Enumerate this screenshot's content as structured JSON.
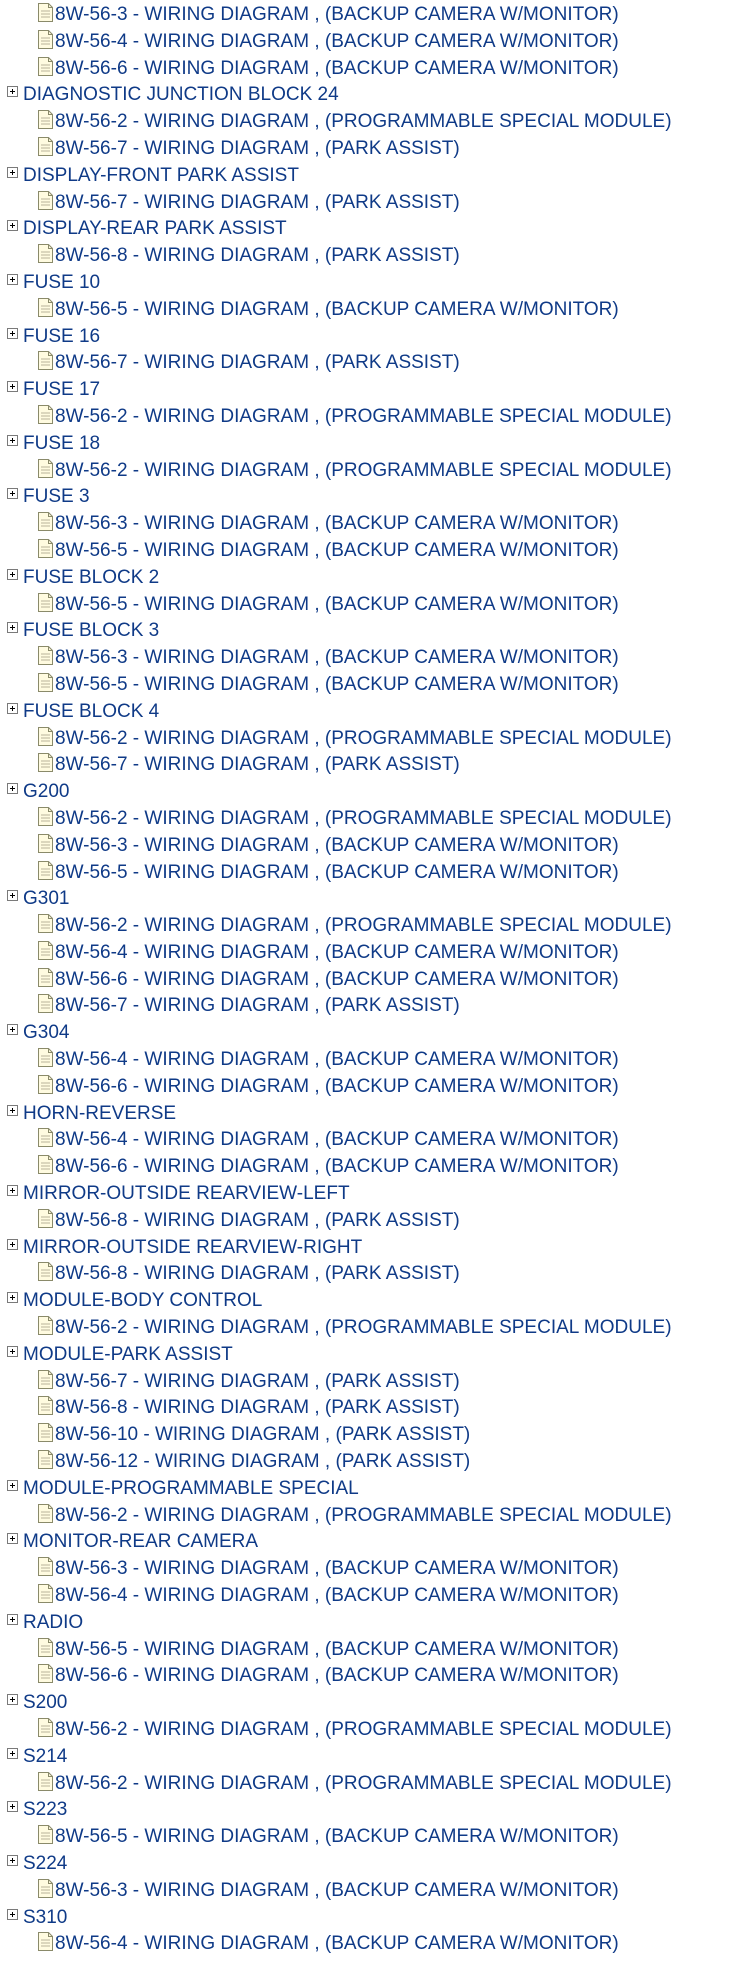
{
  "tree": [
    {
      "type": "doc",
      "label": "8W-56-3 - WIRING DIAGRAM , (BACKUP CAMERA W/MONITOR)"
    },
    {
      "type": "doc",
      "label": "8W-56-4 - WIRING DIAGRAM , (BACKUP CAMERA W/MONITOR)"
    },
    {
      "type": "doc",
      "label": "8W-56-6 - WIRING DIAGRAM , (BACKUP CAMERA W/MONITOR)"
    },
    {
      "type": "group",
      "label": "DIAGNOSTIC JUNCTION BLOCK 24"
    },
    {
      "type": "doc",
      "label": "8W-56-2 - WIRING DIAGRAM , (PROGRAMMABLE SPECIAL MODULE)"
    },
    {
      "type": "doc",
      "label": "8W-56-7 - WIRING DIAGRAM , (PARK ASSIST)"
    },
    {
      "type": "group",
      "label": "DISPLAY-FRONT PARK ASSIST"
    },
    {
      "type": "doc",
      "label": "8W-56-7 - WIRING DIAGRAM , (PARK ASSIST)"
    },
    {
      "type": "group",
      "label": "DISPLAY-REAR PARK ASSIST"
    },
    {
      "type": "doc",
      "label": "8W-56-8 - WIRING DIAGRAM , (PARK ASSIST)"
    },
    {
      "type": "group",
      "label": "FUSE 10"
    },
    {
      "type": "doc",
      "label": "8W-56-5 - WIRING DIAGRAM , (BACKUP CAMERA W/MONITOR)"
    },
    {
      "type": "group",
      "label": "FUSE 16"
    },
    {
      "type": "doc",
      "label": "8W-56-7 - WIRING DIAGRAM , (PARK ASSIST)"
    },
    {
      "type": "group",
      "label": "FUSE 17"
    },
    {
      "type": "doc",
      "label": "8W-56-2 - WIRING DIAGRAM , (PROGRAMMABLE SPECIAL MODULE)"
    },
    {
      "type": "group",
      "label": "FUSE 18"
    },
    {
      "type": "doc",
      "label": "8W-56-2 - WIRING DIAGRAM , (PROGRAMMABLE SPECIAL MODULE)"
    },
    {
      "type": "group",
      "label": "FUSE 3"
    },
    {
      "type": "doc",
      "label": "8W-56-3 - WIRING DIAGRAM , (BACKUP CAMERA W/MONITOR)"
    },
    {
      "type": "doc",
      "label": "8W-56-5 - WIRING DIAGRAM , (BACKUP CAMERA W/MONITOR)"
    },
    {
      "type": "group",
      "label": "FUSE BLOCK 2"
    },
    {
      "type": "doc",
      "label": "8W-56-5 - WIRING DIAGRAM , (BACKUP CAMERA W/MONITOR)"
    },
    {
      "type": "group",
      "label": "FUSE BLOCK 3"
    },
    {
      "type": "doc",
      "label": "8W-56-3 - WIRING DIAGRAM , (BACKUP CAMERA W/MONITOR)"
    },
    {
      "type": "doc",
      "label": "8W-56-5 - WIRING DIAGRAM , (BACKUP CAMERA W/MONITOR)"
    },
    {
      "type": "group",
      "label": "FUSE BLOCK 4"
    },
    {
      "type": "doc",
      "label": "8W-56-2 - WIRING DIAGRAM , (PROGRAMMABLE SPECIAL MODULE)"
    },
    {
      "type": "doc",
      "label": "8W-56-7 - WIRING DIAGRAM , (PARK ASSIST)"
    },
    {
      "type": "group",
      "label": "G200"
    },
    {
      "type": "doc",
      "label": "8W-56-2 - WIRING DIAGRAM , (PROGRAMMABLE SPECIAL MODULE)"
    },
    {
      "type": "doc",
      "label": "8W-56-3 - WIRING DIAGRAM , (BACKUP CAMERA W/MONITOR)"
    },
    {
      "type": "doc",
      "label": "8W-56-5 - WIRING DIAGRAM , (BACKUP CAMERA W/MONITOR)"
    },
    {
      "type": "group",
      "label": "G301"
    },
    {
      "type": "doc",
      "label": "8W-56-2 - WIRING DIAGRAM , (PROGRAMMABLE SPECIAL MODULE)"
    },
    {
      "type": "doc",
      "label": "8W-56-4 - WIRING DIAGRAM , (BACKUP CAMERA W/MONITOR)"
    },
    {
      "type": "doc",
      "label": "8W-56-6 - WIRING DIAGRAM , (BACKUP CAMERA W/MONITOR)"
    },
    {
      "type": "doc",
      "label": "8W-56-7 - WIRING DIAGRAM , (PARK ASSIST)"
    },
    {
      "type": "group",
      "label": "G304"
    },
    {
      "type": "doc",
      "label": "8W-56-4 - WIRING DIAGRAM , (BACKUP CAMERA W/MONITOR)"
    },
    {
      "type": "doc",
      "label": "8W-56-6 - WIRING DIAGRAM , (BACKUP CAMERA W/MONITOR)"
    },
    {
      "type": "group",
      "label": "HORN-REVERSE"
    },
    {
      "type": "doc",
      "label": "8W-56-4 - WIRING DIAGRAM , (BACKUP CAMERA W/MONITOR)"
    },
    {
      "type": "doc",
      "label": "8W-56-6 - WIRING DIAGRAM , (BACKUP CAMERA W/MONITOR)"
    },
    {
      "type": "group",
      "label": "MIRROR-OUTSIDE REARVIEW-LEFT"
    },
    {
      "type": "doc",
      "label": "8W-56-8 - WIRING DIAGRAM , (PARK ASSIST)"
    },
    {
      "type": "group",
      "label": "MIRROR-OUTSIDE REARVIEW-RIGHT"
    },
    {
      "type": "doc",
      "label": "8W-56-8 - WIRING DIAGRAM , (PARK ASSIST)"
    },
    {
      "type": "group",
      "label": "MODULE-BODY CONTROL"
    },
    {
      "type": "doc",
      "label": "8W-56-2 - WIRING DIAGRAM , (PROGRAMMABLE SPECIAL MODULE)"
    },
    {
      "type": "group",
      "label": "MODULE-PARK ASSIST"
    },
    {
      "type": "doc",
      "label": "8W-56-7 - WIRING DIAGRAM , (PARK ASSIST)"
    },
    {
      "type": "doc",
      "label": "8W-56-8 - WIRING DIAGRAM , (PARK ASSIST)"
    },
    {
      "type": "doc",
      "label": "8W-56-10 - WIRING DIAGRAM , (PARK ASSIST)"
    },
    {
      "type": "doc",
      "label": "8W-56-12 - WIRING DIAGRAM , (PARK ASSIST)"
    },
    {
      "type": "group",
      "label": "MODULE-PROGRAMMABLE SPECIAL"
    },
    {
      "type": "doc",
      "label": "8W-56-2 - WIRING DIAGRAM , (PROGRAMMABLE SPECIAL MODULE)"
    },
    {
      "type": "group",
      "label": "MONITOR-REAR CAMERA"
    },
    {
      "type": "doc",
      "label": "8W-56-3 - WIRING DIAGRAM , (BACKUP CAMERA W/MONITOR)"
    },
    {
      "type": "doc",
      "label": "8W-56-4 - WIRING DIAGRAM , (BACKUP CAMERA W/MONITOR)"
    },
    {
      "type": "group",
      "label": "RADIO"
    },
    {
      "type": "doc",
      "label": "8W-56-5 - WIRING DIAGRAM , (BACKUP CAMERA W/MONITOR)"
    },
    {
      "type": "doc",
      "label": "8W-56-6 - WIRING DIAGRAM , (BACKUP CAMERA W/MONITOR)"
    },
    {
      "type": "group",
      "label": "S200"
    },
    {
      "type": "doc",
      "label": "8W-56-2 - WIRING DIAGRAM , (PROGRAMMABLE SPECIAL MODULE)"
    },
    {
      "type": "group",
      "label": "S214"
    },
    {
      "type": "doc",
      "label": "8W-56-2 - WIRING DIAGRAM , (PROGRAMMABLE SPECIAL MODULE)"
    },
    {
      "type": "group",
      "label": "S223"
    },
    {
      "type": "doc",
      "label": "8W-56-5 - WIRING DIAGRAM , (BACKUP CAMERA W/MONITOR)"
    },
    {
      "type": "group",
      "label": "S224"
    },
    {
      "type": "doc",
      "label": "8W-56-3 - WIRING DIAGRAM , (BACKUP CAMERA W/MONITOR)"
    },
    {
      "type": "group",
      "label": "S310"
    },
    {
      "type": "doc",
      "label": "8W-56-4 - WIRING DIAGRAM , (BACKUP CAMERA W/MONITOR)"
    }
  ],
  "colors": {
    "link_text": "#0f3a87",
    "doc_icon_fill": "#fffbe0",
    "doc_icon_stroke": "#8a8a6a",
    "toggle_border": "#7a7a7a"
  },
  "icons": {
    "group_toggle": "expand-plus-icon",
    "document": "document-icon"
  }
}
